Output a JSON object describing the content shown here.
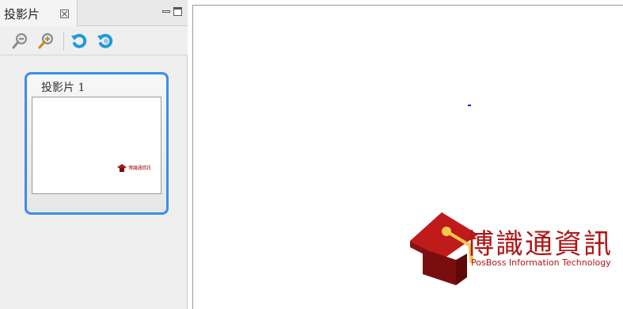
{
  "panel": {
    "tab_label": "投影片",
    "toolbar_icons": [
      "zoom-out-icon",
      "zoom-in-icon",
      "rotate-left-icon",
      "rotate-right-icon"
    ]
  },
  "thumbnails": [
    {
      "label": "投影片 1",
      "logo_text": "博識通資訊"
    }
  ],
  "slide": {
    "logo_text": "博識通資訊",
    "logo_subtitle": "PosBoss Information Technology"
  },
  "colors": {
    "accent": "#3a8ee8",
    "logo_red": "#b01616"
  }
}
